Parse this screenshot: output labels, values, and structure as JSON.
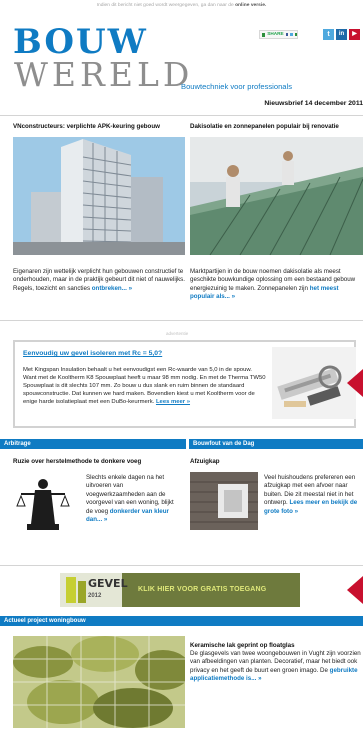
{
  "top_note": {
    "text": "Indien dit bericht niet goed wordt weergegeven, ga dan naar de",
    "link": "online versie."
  },
  "logo": {
    "line1": "BOUW",
    "line2": "WERELD"
  },
  "tagline": "Bouwtechniek voor professionals",
  "share": {
    "label": "SHARE"
  },
  "social": [
    {
      "icon": "twitter-icon",
      "label": "t",
      "color": "#4fa9de"
    },
    {
      "icon": "linkedin-icon",
      "label": "in",
      "color": "#1f6aa8"
    },
    {
      "icon": "youtube-icon",
      "label": "▶",
      "color": "#c8102e"
    }
  ],
  "newsletter_date": "Nieuwsbrief 14 december 2011",
  "articles": {
    "left": {
      "title": "VNconstructeurs: verplichte APK-keuring gebouw",
      "text": "Eigenaren zijn wettelijk verplicht hun gebouwen constructief te onderhouden, maar in de praktijk gebeurt dit niet of nauwelijks. Regels, toezicht en sancties",
      "link": "ontbreken... »"
    },
    "right": {
      "title": "Dakisolatie en zonnepanelen populair bij renovatie",
      "text": "Marktpartijen in de bouw noemen dakisolatie als meest geschikte bouwkundige oplossing om een bestaand gebouw energiezuinig te maken. Zonnepanelen zijn",
      "link": "het meest populair als... »"
    }
  },
  "advertisement": {
    "label": "advertentie",
    "title": "Eenvoudig uw gevel isoleren met Rc = 5,0?",
    "body": "Met Kingspan Insulation behaalt u het eenvoudigst een Rc-waarde van 5,0 in de spouw. Want met de Kooltherm K8 Spouwplaat heeft u maar 98 mm nodig. En met de Therma TW50 Spouwplaat is dit slechts 107 mm. Zo bouw u dus slank en ruim binnen de standaard spouwconstructie. Dat kunnen we hard maken. Bovendien kiest u met Kooltherm voor de enige harde isolatieplaat met een DuBo-keurmerk.",
    "link": "Lees meer »"
  },
  "sections": {
    "arbitrage": {
      "bar": "Arbitrage",
      "title": "Ruzie over herstelmethode te donkere voeg",
      "text": "Slechts enkele dagen na het uitvoeren van voegwerkzaamheden aan de voorgevel van een woning, blijkt de voeg",
      "link": "donkerder van kleur dan... »"
    },
    "bouwfout": {
      "bar": "Bouwfout van de Dag",
      "title": "Afzuigkap",
      "text": "Veel huishoudens prefereren een afzuigkap met een afvoer naar buiten. Die zit meestal niet in het ontwerp.",
      "link": "Lees meer en bekijk de grote foto »"
    },
    "woningbouw": {
      "bar": "Actueel project woningbouw",
      "title": "Keramische lak geprint op floatglas",
      "text": "De glasgevels van twee woongebouwen in Vught zijn voorzien van afbeeldingen van planten. Decoratief, maar het biedt ook privacy en het geeft de buurt een groen imago. De",
      "link": "gebruikte applicatiemethode is... »"
    }
  },
  "banner": {
    "brand": "GEVEL",
    "year": "2012",
    "cta": "KLIK HIER VOOR GRATIS TOEGANG"
  },
  "colors": {
    "brand_blue": "#0f7bc3",
    "bar_blue": "#0f7bc3",
    "accent_red": "#c8102e"
  }
}
